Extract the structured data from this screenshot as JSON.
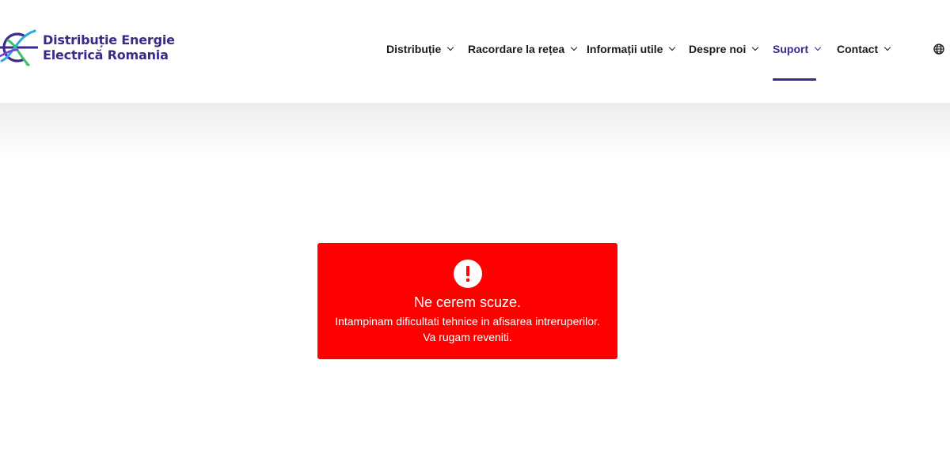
{
  "brand": {
    "name_line1": "Distribuție Energie",
    "name_line2": "Electrică Romania",
    "color": "#3a2a8a",
    "logo_icon": "electrica-logo-icon"
  },
  "nav": {
    "items": [
      {
        "label": "Distribuție",
        "active": false
      },
      {
        "label": "Racordare la rețea",
        "active": false
      },
      {
        "label": "Informații utile",
        "active": false
      },
      {
        "label": "Despre noi",
        "active": false
      },
      {
        "label": "Suport",
        "active": true
      },
      {
        "label": "Contact",
        "active": false
      }
    ],
    "language_icon": "globe-icon",
    "active_color": "#3a2a8a"
  },
  "error": {
    "icon": "exclamation-icon",
    "title": "Ne cerem scuze.",
    "message_line1": "Intampinam dificultati tehnice in afisarea intreruperilor.",
    "message_line2": "Va rugam reveniti.",
    "background_color": "#ff0000"
  }
}
